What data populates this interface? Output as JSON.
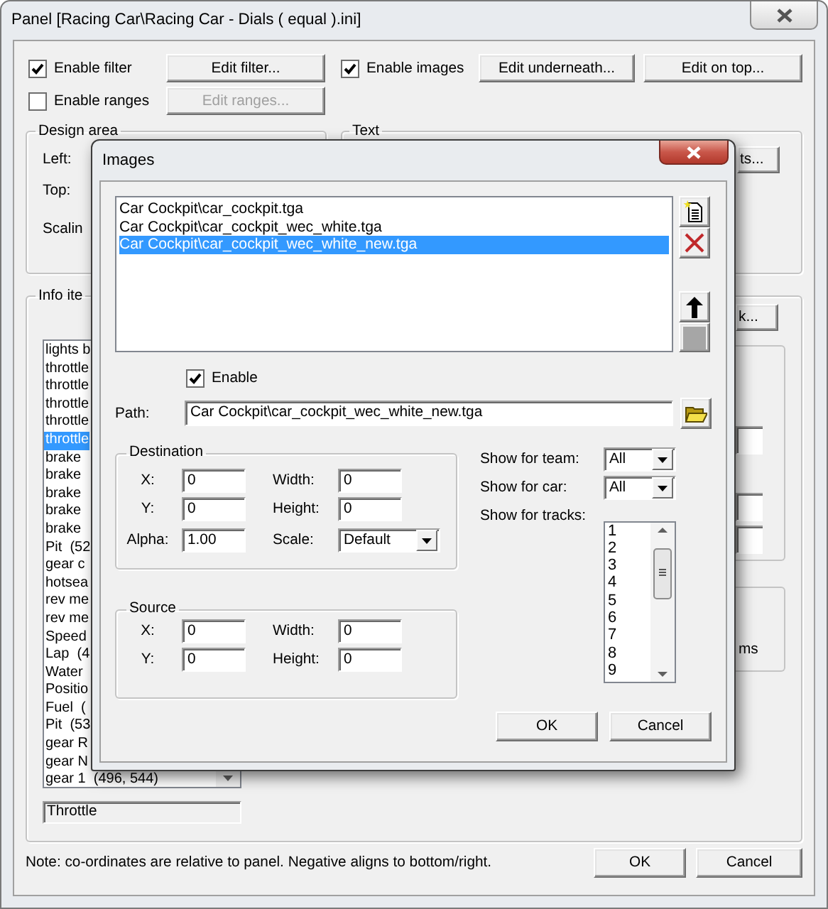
{
  "window": {
    "title": "Panel [Racing Car\\Racing Car - Dials ( equal ).ini]"
  },
  "options": {
    "enable_filter": {
      "label": "Enable filter",
      "checked": true
    },
    "edit_filter": {
      "label": "Edit filter...",
      "disabled": false
    },
    "enable_images": {
      "label": "Enable images",
      "checked": true
    },
    "edit_underneath": {
      "label": "Edit underneath...",
      "disabled": false
    },
    "edit_on_top": {
      "label": "Edit on top...",
      "disabled": false
    },
    "enable_ranges": {
      "label": "Enable ranges",
      "checked": false
    },
    "edit_ranges": {
      "label": "Edit ranges...",
      "disabled": true
    }
  },
  "design_area": {
    "title": "Design area",
    "labels": [
      "Left:",
      "Top:",
      "Scalin"
    ]
  },
  "text_group": {
    "title": "Text",
    "button": "ts..."
  },
  "info_items": {
    "title": "Info ite",
    "button": "k...",
    "items": [
      {
        "label": "lights b",
        "selected": false
      },
      {
        "label": "throttle",
        "selected": false
      },
      {
        "label": "throttle",
        "selected": false
      },
      {
        "label": "throttle",
        "selected": false
      },
      {
        "label": "throttle",
        "selected": false
      },
      {
        "label": "throttle",
        "selected": true
      },
      {
        "label": "brake",
        "selected": false
      },
      {
        "label": "brake",
        "selected": false
      },
      {
        "label": "brake",
        "selected": false
      },
      {
        "label": "brake",
        "selected": false
      },
      {
        "label": "brake",
        "selected": false
      },
      {
        "label": "Pit  (52",
        "selected": false
      },
      {
        "label": "gear c",
        "selected": false
      },
      {
        "label": "hotsea",
        "selected": false
      },
      {
        "label": "rev me",
        "selected": false
      },
      {
        "label": "rev me",
        "selected": false
      },
      {
        "label": "Speed",
        "selected": false
      },
      {
        "label": "Lap  (4",
        "selected": false
      },
      {
        "label": "Water",
        "selected": false
      },
      {
        "label": "Positio",
        "selected": false
      },
      {
        "label": "Fuel  (",
        "selected": false
      },
      {
        "label": "Pit  (53",
        "selected": false
      },
      {
        "label": "gear R",
        "selected": false
      },
      {
        "label": "gear N",
        "selected": false
      },
      {
        "label": "gear 1  (496, 544)",
        "selected": false
      }
    ],
    "name_field": {
      "value": "Throttle"
    },
    "units": "ms"
  },
  "note": "Note: co-ordinates are relative to panel. Negative aligns to bottom/right.",
  "buttons": [
    "OK",
    "Cancel"
  ],
  "images_dialog": {
    "title": "Images",
    "files": [
      {
        "label": "Car Cockpit\\car_cockpit.tga",
        "selected": false
      },
      {
        "label": "Car Cockpit\\car_cockpit_wec_white.tga",
        "selected": false
      },
      {
        "label": "Car Cockpit\\car_cockpit_wec_white_new.tga",
        "selected": true
      }
    ],
    "enable": {
      "label": "Enable",
      "checked": true
    },
    "path": {
      "label": "Path:",
      "value": "Car Cockpit\\car_cockpit_wec_white_new.tga"
    },
    "destination": {
      "title": "Destination",
      "fields": [
        {
          "label": "X:",
          "value": "0",
          "kind": "text"
        },
        {
          "label": "Width:",
          "value": "0",
          "kind": "text"
        },
        {
          "label": "Y:",
          "value": "0",
          "kind": "text"
        },
        {
          "label": "Height:",
          "value": "0",
          "kind": "text"
        },
        {
          "label": "Alpha:",
          "value": "1.00",
          "kind": "text"
        },
        {
          "label": "Scale:",
          "value": "Default",
          "kind": "dropdown"
        }
      ]
    },
    "source": {
      "title": "Source",
      "fields": [
        {
          "label": "X:",
          "value": "0",
          "kind": "text"
        },
        {
          "label": "Width:",
          "value": "0",
          "kind": "text"
        },
        {
          "label": "Y:",
          "value": "0",
          "kind": "text"
        },
        {
          "label": "Height:",
          "value": "0",
          "kind": "text"
        }
      ]
    },
    "show_for_team": {
      "label": "Show for team:",
      "value": "All"
    },
    "show_for_car": {
      "label": "Show for car:",
      "value": "All"
    },
    "show_for_tracks": {
      "label": "Show for tracks:",
      "items": [
        "1",
        "2",
        "3",
        "4",
        "5",
        "6",
        "7",
        "8",
        "9"
      ]
    },
    "buttons": [
      "OK",
      "Cancel"
    ]
  }
}
